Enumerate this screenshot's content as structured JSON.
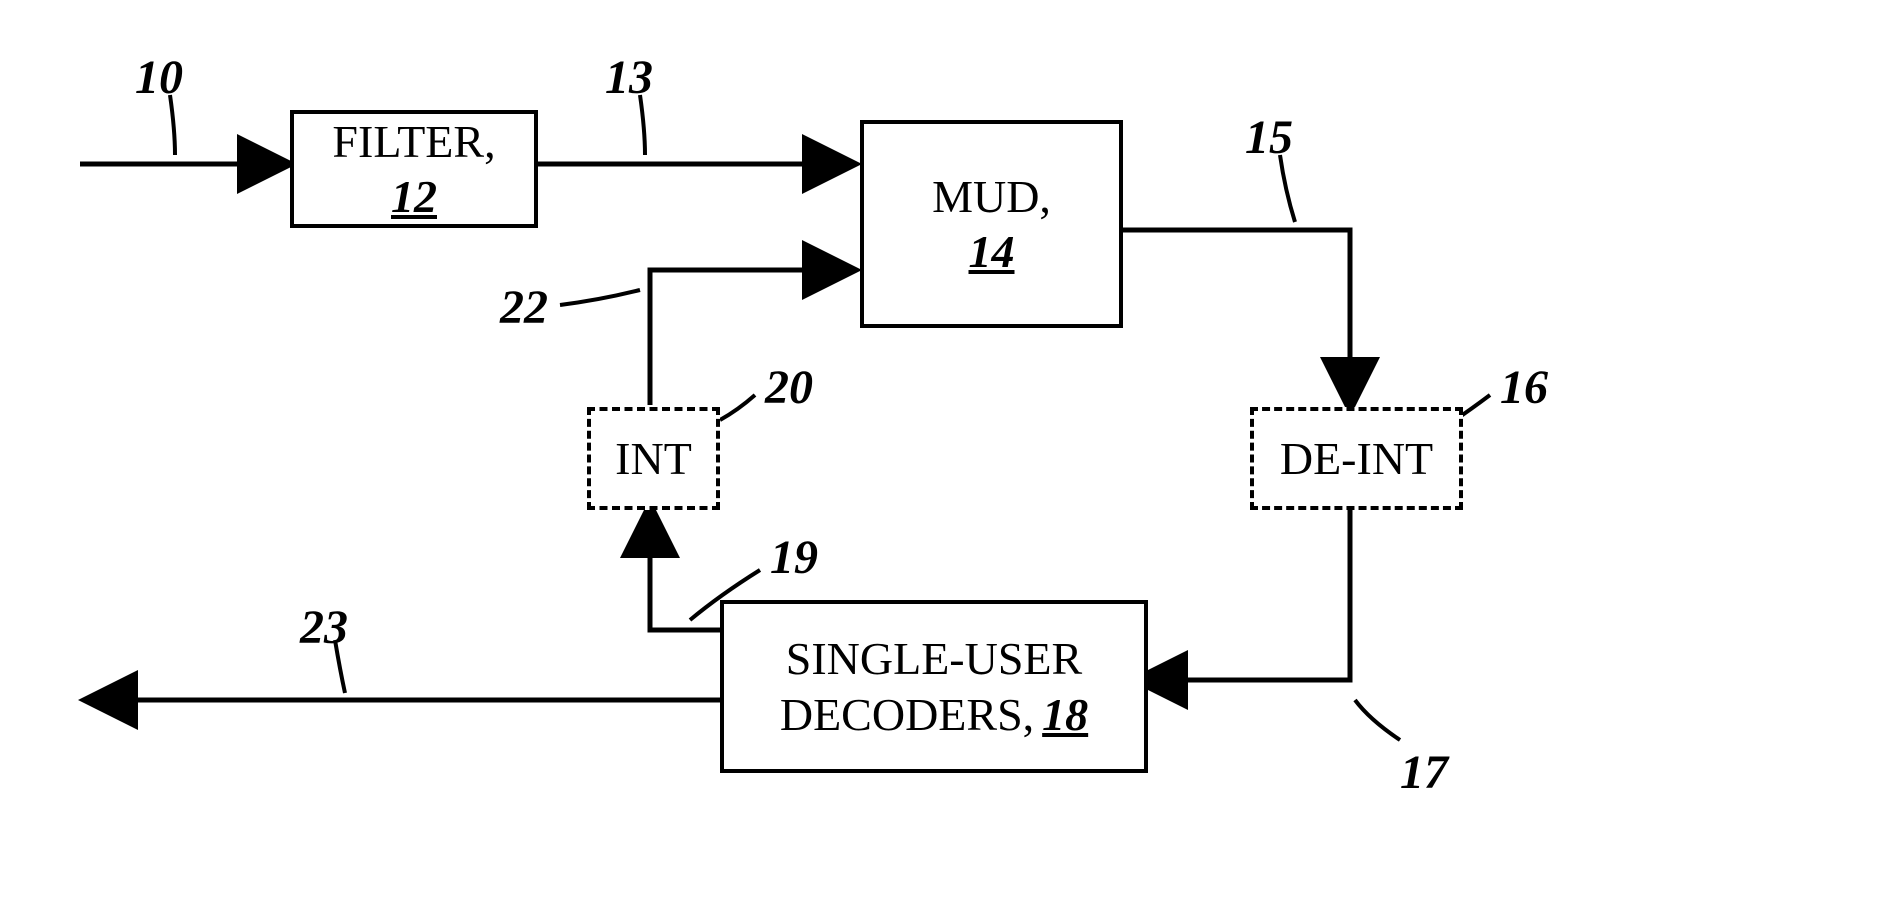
{
  "blocks": {
    "filter": {
      "label": "FILTER,",
      "num": "12"
    },
    "mud": {
      "label": "MUD,",
      "num": "14"
    },
    "int": {
      "label": "INT"
    },
    "deint": {
      "label": "DE-INT"
    },
    "decoders": {
      "label_prefix": "SINGLE-USER",
      "label2": "DECODERS,",
      "num": "18"
    }
  },
  "refs": {
    "r10": "10",
    "r13": "13",
    "r15": "15",
    "r16": "16",
    "r17": "17",
    "r19": "19",
    "r20": "20",
    "r22": "22",
    "r23": "23"
  }
}
